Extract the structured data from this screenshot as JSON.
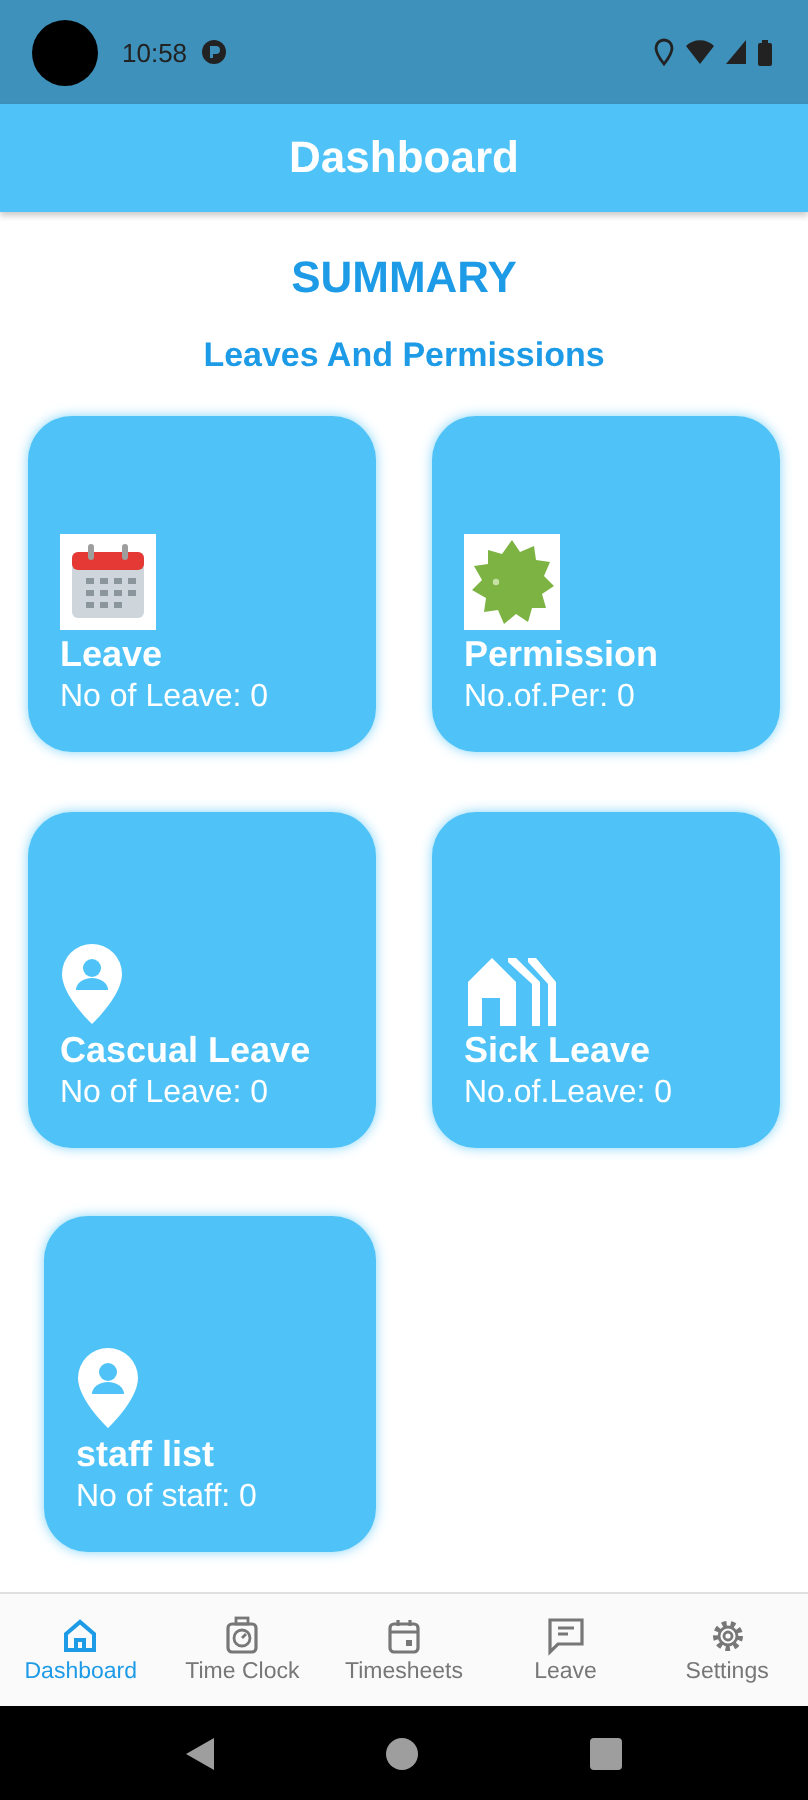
{
  "status_bar": {
    "time": "10:58"
  },
  "app_bar": {
    "title": "Dashboard"
  },
  "summary": {
    "title": "SUMMARY",
    "subtitle": "Leaves And Permissions"
  },
  "cards": [
    {
      "kind": "calendar",
      "title": "Leave",
      "count": "No of Leave: 0"
    },
    {
      "kind": "badge",
      "title": "Permission",
      "count": "No.of.Per: 0"
    },
    {
      "kind": "pin",
      "title": "Cascual Leave",
      "count": "No of Leave: 0"
    },
    {
      "kind": "house",
      "title": "Sick Leave",
      "count": "No.of.Leave: 0"
    },
    {
      "kind": "pin",
      "title": "staff list",
      "count": "No of staff: 0"
    }
  ],
  "bottom_nav": [
    {
      "kind": "home",
      "label": "Dashboard",
      "selected": true
    },
    {
      "kind": "clock",
      "label": "Time Clock",
      "selected": false
    },
    {
      "kind": "calendar",
      "label": "Timesheets",
      "selected": false
    },
    {
      "kind": "chat",
      "label": "Leave",
      "selected": false
    },
    {
      "kind": "gear",
      "label": "Settings",
      "selected": false
    }
  ]
}
